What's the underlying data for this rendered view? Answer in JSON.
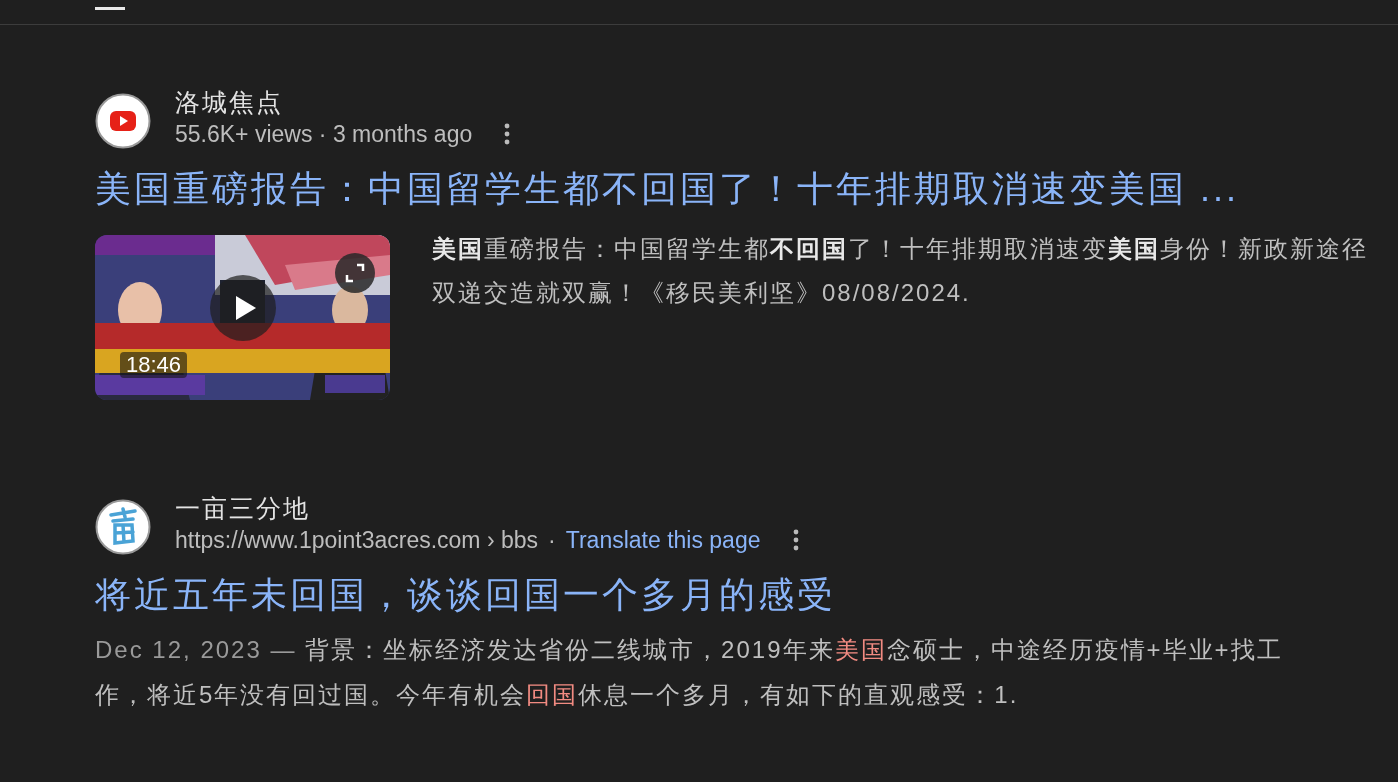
{
  "results": [
    {
      "kind": "video",
      "site": "洛城焦点",
      "meta": "55.6K+ views · 3 months ago",
      "title": "美国重磅报告：中国留学生都不回国了！十年排期取消速变美国 ...",
      "thumbnail": {
        "kind": "picture",
        "duration": "18:46"
      },
      "snippet": [
        {
          "kind": "plain",
          "text": "**美国**重磅报告：中国留学生都**不回国**了！十年排期取消速变**美国**身份！新政新途径双递交造就双赢！《移民美利坚》08/08/2024."
        }
      ]
    },
    {
      "kind": "page",
      "site": "一亩三分地",
      "url": "https://www.1point3acres.com › bbs",
      "separator": "·",
      "translate": "Translate this page",
      "title": "将近五年未回国，谈谈回国一个多月的感受",
      "snippet": [
        {
          "kind": "date",
          "text": "Dec 12, 2023 — "
        },
        {
          "kind": "plain",
          "text": "背景：坐标经济发达省份二线城市，2019年来"
        },
        {
          "kind": "highlight",
          "text": "美国"
        },
        {
          "kind": "plain",
          "text": "念硕士，中途经历疫情+毕业+找工作，将近5年没有回过国。今年有机会"
        },
        {
          "kind": "highlight",
          "text": "回国"
        },
        {
          "kind": "plain",
          "text": "休息一个多月，有如下的直观感受：1."
        }
      ]
    }
  ]
}
